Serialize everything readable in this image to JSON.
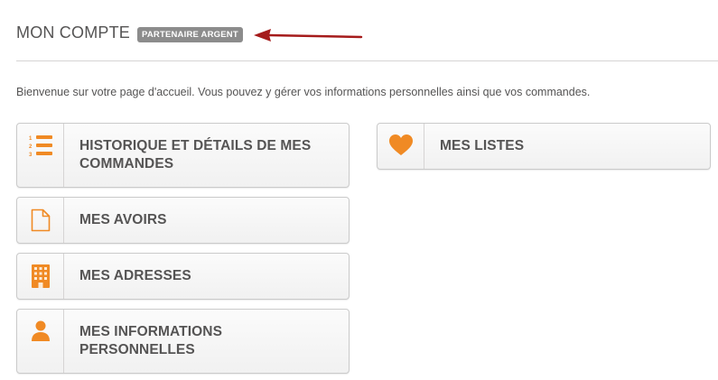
{
  "header": {
    "title": "MON COMPTE",
    "badge": "PARTENAIRE ARGENT"
  },
  "intro": "Bienvenue sur votre page d'accueil. Vous pouvez y gérer vos informations personnelles ainsi que vos commandes.",
  "colors": {
    "accent": "#f08a24",
    "arrow": "#a51b1b",
    "badge_bg": "#8c8c8c",
    "text": "#555454"
  },
  "tiles": [
    {
      "label": "HISTORIQUE ET DÉTAILS DE MES COMMANDES",
      "icon": "ordered-list-icon"
    },
    {
      "label": "MES AVOIRS",
      "icon": "document-icon"
    },
    {
      "label": "MES ADRESSES",
      "icon": "building-icon"
    },
    {
      "label": "MES INFORMATIONS PERSONNELLES",
      "icon": "user-icon"
    },
    {
      "label": "MES LISTES",
      "icon": "heart-icon"
    }
  ]
}
